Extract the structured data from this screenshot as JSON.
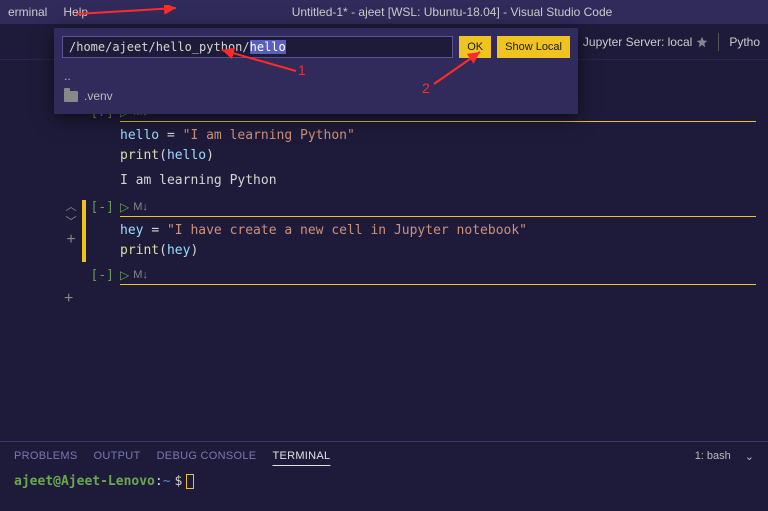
{
  "menubar": {
    "terminal": "erminal",
    "help": "Help"
  },
  "title": "Untitled-1* - ajeet [WSL: Ubuntu-18.04] - Visual Studio Code",
  "toolbar": {
    "jupyter_server": "Jupyter Server: local",
    "kernel": "Pytho"
  },
  "dialog": {
    "path_prefix": "/home/ajeet/hello_python/",
    "path_selected": "hello",
    "ok": "OK",
    "show_local": "Show Local",
    "items": {
      "parent": "..",
      "venv": ".venv"
    }
  },
  "cells": [
    {
      "exec": "[7]",
      "runbar": "▷ M↓",
      "code_html": "<span class=\"tok-var\">hello</span> <span class=\"tok-op\">=</span> <span class=\"tok-str\">\"I am learning Python\"</span>\n<span class=\"tok-fn\">print</span>(<span class=\"tok-var\">hello</span>)",
      "output": "I am learning Python"
    },
    {
      "exec": "[-]",
      "runbar": "▷ M↓",
      "code_html": "<span class=\"tok-var\">hey</span> <span class=\"tok-op\">=</span> <span class=\"tok-str\">\"I have create a new cell in Jupyter notebook\"</span>\n<span class=\"tok-fn\">print</span>(<span class=\"tok-var\">hey</span>)"
    },
    {
      "exec": "[-]",
      "runbar": "▷ M↓"
    }
  ],
  "panel": {
    "tabs": {
      "problems": "PROBLEMS",
      "output": "OUTPUT",
      "debug_console": "DEBUG CONSOLE",
      "terminal": "TERMINAL"
    },
    "shell": "1: bash"
  },
  "terminal": {
    "user": "ajeet",
    "host": "Ajeet-Lenovo",
    "path": "~",
    "prompt": "$"
  },
  "annotations": {
    "label1": "1",
    "label2": "2"
  }
}
